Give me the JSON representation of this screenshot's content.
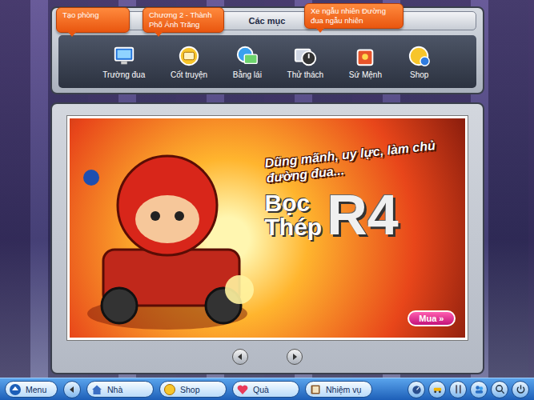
{
  "window": {
    "title": "Các mục"
  },
  "tooltips": [
    {
      "label": "Tạo phòng"
    },
    {
      "label": "Chương 2 - Thành Phố Ánh Trăng"
    },
    {
      "label": "Xe ngẫu nhiên Đường đua ngẫu nhiên"
    }
  ],
  "menu": {
    "items": [
      {
        "label": "Trường đua"
      },
      {
        "label": "Cốt truyện"
      },
      {
        "label": "Bằng lái"
      },
      {
        "label": "Thử thách"
      },
      {
        "label": "Sứ Mệnh"
      },
      {
        "label": "Shop"
      }
    ]
  },
  "banner": {
    "tagline": "Dũng mãnh, uy lực, làm chủ đường đua...",
    "title_top": "Bọc",
    "title_bottom": "Thép",
    "model": "R4",
    "button": "Mua »"
  },
  "taskbar": {
    "items": [
      {
        "label": "Menu"
      },
      {
        "label": "Nhà"
      },
      {
        "label": "Shop"
      },
      {
        "label": "Quà"
      },
      {
        "label": "Nhiệm vụ"
      }
    ]
  }
}
